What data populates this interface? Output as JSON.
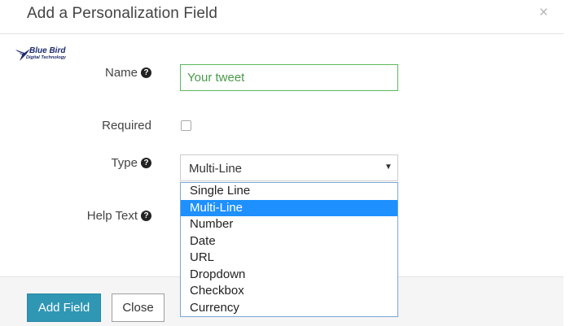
{
  "dialog": {
    "title": "Add a Personalization Field",
    "close_glyph": "×",
    "close_icon": "close-icon"
  },
  "logo": {
    "name": "Blue Bird",
    "tagline": "Digital Technology",
    "icon": "bird-icon"
  },
  "form": {
    "name_label": "Name",
    "name_value": "Your tweet",
    "required_label": "Required",
    "required_checked": false,
    "type_label": "Type",
    "type_value": "Multi-Line",
    "help_text_label": "Help Text",
    "help_glyph": "?",
    "help_icon": "question-circle-icon",
    "caret_icon": "caret-down-icon"
  },
  "type_options": [
    {
      "label": "Single Line",
      "selected": false
    },
    {
      "label": "Multi-Line",
      "selected": true
    },
    {
      "label": "Number",
      "selected": false
    },
    {
      "label": "Date",
      "selected": false
    },
    {
      "label": "URL",
      "selected": false
    },
    {
      "label": "Dropdown",
      "selected": false
    },
    {
      "label": "Checkbox",
      "selected": false
    },
    {
      "label": "Currency",
      "selected": false
    }
  ],
  "footer": {
    "add_label": "Add Field",
    "close_label": "Close"
  },
  "colors": {
    "primary_button": "#2f96b4",
    "input_focus_border": "#5cb85c",
    "selected_option": "#1e90ff",
    "logo_text": "#1d2a6b"
  }
}
